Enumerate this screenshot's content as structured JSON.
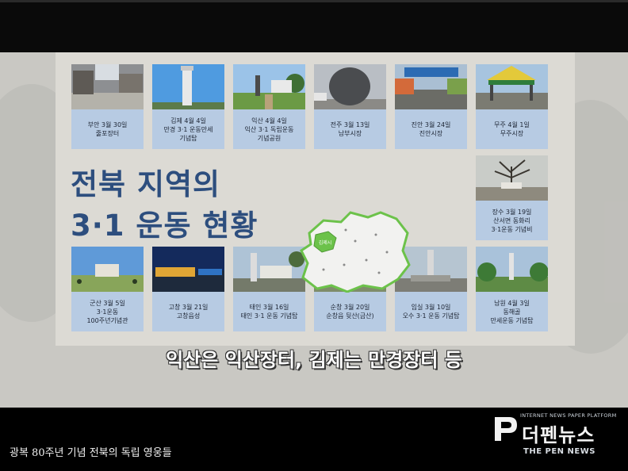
{
  "infographic": {
    "title_line1": "전북 지역의",
    "title_line2": "3·1 운동 현황",
    "cards": [
      {
        "caption": "부안 3월 30일\n줄포장터"
      },
      {
        "caption": "김제 4월 4일\n만경 3·1 운동만세\n기념탑"
      },
      {
        "caption": "익산 4월 4일\n익산 3·1 독립운동\n기념공원"
      },
      {
        "caption": "전주 3월 13일\n남부시장"
      },
      {
        "caption": "진안 3월 24일\n진안시장"
      },
      {
        "caption": "무주 4월 1일\n무주시장"
      },
      {
        "caption": "장수 3월 19일\n산서면 동화리\n3·1운동 기념비"
      },
      {
        "caption": "군산 3월 5일\n3·1운동\n100주년기념관"
      },
      {
        "caption": "고창 3월 21일\n고창읍성"
      },
      {
        "caption": "태인 3월 16일\n태인 3·1 운동 기념탑"
      },
      {
        "caption": "순창 3월 20일\n순창읍 뒷산(금산)"
      },
      {
        "caption": "임실 3월 10일\n오수 3·1 운동 기념탑"
      },
      {
        "caption": "남원 4월 3일\n동해골\n만세운동 기념탑"
      }
    ],
    "map_highlight": "김제시"
  },
  "subtitle": "익산은 익산장터, 김제는 만경장터 등",
  "caption": "광복 80주년 기념 전북의 독립 영웅들",
  "logo": {
    "tagline": "INTERNET NEWS PAPER PLATFORM",
    "brand": "더펜뉴스",
    "english": "THE PEN NEWS"
  },
  "colors": {
    "accent": "#2d4e7e",
    "card": "#b7cbe3",
    "map_green": "#6cc24a"
  }
}
